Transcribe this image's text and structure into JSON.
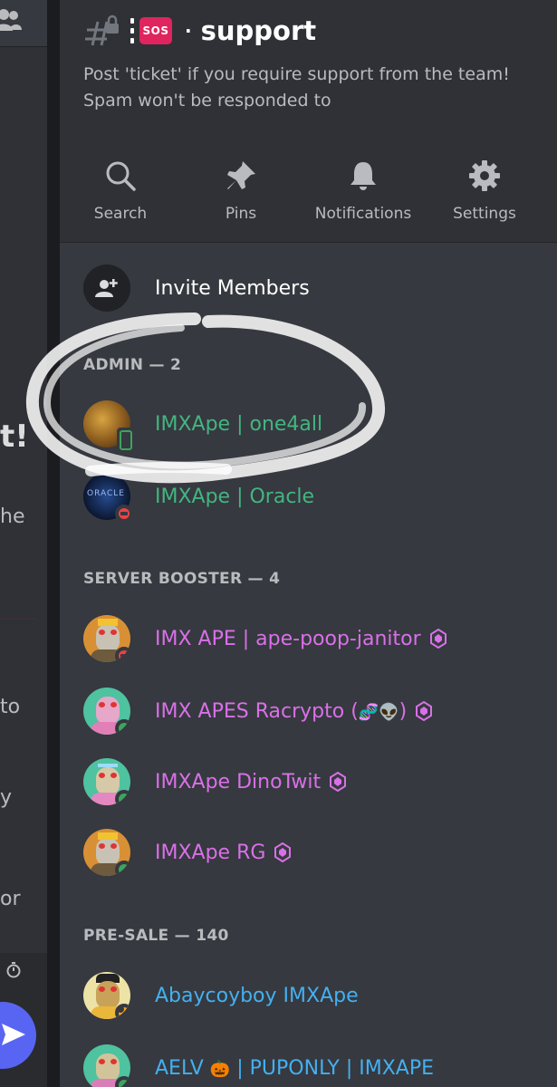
{
  "background": {
    "fragments": [
      "t!",
      "he",
      "to",
      "y",
      "or"
    ]
  },
  "channel": {
    "badge": "SOS",
    "name": "support",
    "topic": "Post 'ticket' if you require support from the team! Spam won't be responded to"
  },
  "actions": [
    {
      "label": "Search",
      "icon": "search-icon"
    },
    {
      "label": "Pins",
      "icon": "pin-icon"
    },
    {
      "label": "Notifications",
      "icon": "bell-icon"
    },
    {
      "label": "Settings",
      "icon": "gear-icon"
    }
  ],
  "invite": {
    "label": "Invite Members"
  },
  "sections": [
    {
      "title": "ADMIN — 2"
    },
    {
      "title": "SERVER BOOSTER — 4"
    },
    {
      "title": "PRE-SALE — 140"
    }
  ],
  "members": [
    {
      "name": "IMXApe | one4all",
      "role_color": "#43b581",
      "status": "mobile"
    },
    {
      "name": "IMXApe | Oracle",
      "role_color": "#43b581",
      "status": "dnd",
      "avatar_text": "ORACLE"
    },
    {
      "name": "IMX APE | ape-poop-janitor",
      "role_color": "#d970e8",
      "status": "dnd",
      "booster": true
    },
    {
      "name": "IMX APES Racrypto (",
      "name_suffix": ")",
      "emoji": "🧬👽",
      "role_color": "#d970e8",
      "status": "online",
      "booster": true
    },
    {
      "name": "IMXApe DinoTwit",
      "role_color": "#d970e8",
      "status": "online",
      "booster": true
    },
    {
      "name": "IMXApe RG",
      "role_color": "#d970e8",
      "status": "online",
      "booster": true
    },
    {
      "name": "Abaycoyboy IMXApe",
      "role_color": "#43b0f1",
      "status": "idle"
    },
    {
      "name": "AELV ",
      "emoji": "🎃",
      "name_suffix": " | PUPONLY | IMXAPE",
      "role_color": "#43b0f1",
      "status": "online"
    }
  ],
  "colors": {
    "accent": "#5865f2",
    "online": "#3ba55d",
    "dnd": "#ed4245",
    "idle": "#faa61a"
  }
}
